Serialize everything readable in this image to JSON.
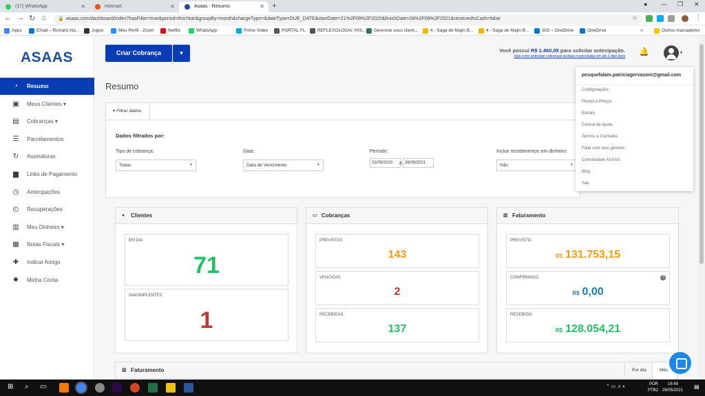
{
  "browser": {
    "tabs": [
      {
        "label": "(17) WhatsApp",
        "color": "#25d366"
      },
      {
        "label": "Hotmart",
        "color": "#f04e23"
      },
      {
        "label": "Asaas - Resumo",
        "color": "#1e4fa0"
      }
    ],
    "new_tab": "+",
    "url": "asaas.com/dashboard/index?hasFilter=true&period=thisYear&groupBy=month&chargeType=&dateType=DUE_DATE&startDate=21%2F09%2F2020&finishDate=28%2F09%2F2021&receivedInCash=false",
    "bookmarks": [
      "Apps",
      "Email – Richard Ala...",
      "Jogos",
      "Meu Perfil - Zoom",
      "Netflix",
      "WhatsApp",
      "Prime Video",
      "PORTAL FL",
      "REFLEXOLOGIA: HIS...",
      "Gerencie seus client...",
      "4 - Saga de Majin B...",
      "4 - Saga de Majin B...",
      "S02 – OneDrive",
      "OneDrive"
    ],
    "other_bookmarks": "Outros marcadores",
    "bookmarks_more": "»"
  },
  "sidebar": {
    "logo": "ASAAS",
    "items": [
      {
        "label": "Resumo",
        "icon": "dashboard-icon",
        "glyph": "◔"
      },
      {
        "label": "Meus Clientes ▾",
        "icon": "contacts-icon",
        "glyph": "▣"
      },
      {
        "label": "Cobranças ▾",
        "icon": "money-icon",
        "glyph": "▤"
      },
      {
        "label": "Parcelamentos",
        "icon": "list-icon",
        "glyph": "☰"
      },
      {
        "label": "Assinaturas",
        "icon": "refresh-icon",
        "glyph": "↻"
      },
      {
        "label": "Links de Pagamento",
        "icon": "briefcase-icon",
        "glyph": "▆"
      },
      {
        "label": "Antecipações",
        "icon": "clock-icon",
        "glyph": "◷"
      },
      {
        "label": "Recuperações",
        "icon": "recover-icon",
        "glyph": "◴"
      },
      {
        "label": "Meu Dinheiro ▾",
        "icon": "bank-icon",
        "glyph": "▥"
      },
      {
        "label": "Notas Fiscais ▾",
        "icon": "document-icon",
        "glyph": "▦"
      },
      {
        "label": "Indicar Amigo",
        "icon": "add-user-icon",
        "glyph": "✚"
      },
      {
        "label": "Minha Conta",
        "icon": "gear-icon",
        "glyph": "✹"
      }
    ]
  },
  "header": {
    "criar_label": "Criar Cobrança",
    "caret": "▾",
    "anticip_prefix": "Você possui ",
    "anticip_value": "R$ 1.460,05",
    "anticip_suffix": " para solicitar antecipação.",
    "anticip_link": "Veja como antecipar cobranças avulsas e parceladas em até 2 dias úteis",
    "bell": "🔔",
    "avatar_caret": "▾"
  },
  "page": {
    "title": "Resumo"
  },
  "filter": {
    "tab_label": "▾  Filtrar dados",
    "subtitle": "Dados filtrados por:",
    "tipo_label": "Tipo de cobrança:",
    "tipo_value": "Todas",
    "data_label": "Data:",
    "data_value": "Data de Vencimento",
    "periodo_label": "Período:",
    "periodo_start": "21/09/2020",
    "periodo_sep": "a",
    "periodo_end": "28/09/2021",
    "incluir_label": "Incluir recebimentos em dinheiro:",
    "incluir_value": "Não"
  },
  "user_menu": {
    "email": "pesquefalam.patriciagervasoni@gmail.com",
    "items": [
      "Configurações",
      "Planos e Preços",
      "Extrato",
      "Central de Ajuda",
      "Termos e Contratos",
      "Falar com meu gerente",
      "Comunidade ASAAS",
      "Blog",
      "Sair"
    ]
  },
  "cards": {
    "clientes": {
      "title": "Clientes",
      "em_dia_label": "Em dia",
      "em_dia_value": "71",
      "inadimplentes_label": "Inadimplentes",
      "inadimplentes_value": "1"
    },
    "cobrancas": {
      "title": "Cobranças",
      "previstas_label": "Previstas",
      "previstas_value": "143",
      "vencidas_label": "Vencidas",
      "vencidas_value": "2",
      "recebidas_label": "Recebidas",
      "recebidas_value": "137"
    },
    "faturamento": {
      "title": "Faturamento",
      "currency": "R$",
      "previsto_label": "Previsto",
      "previsto_value": "131.753,15",
      "confirmado_label": "Confirmado",
      "confirmado_value": "0,00",
      "recebido_label": "Recebido",
      "recebido_value": "128.054,21",
      "help": "?"
    }
  },
  "faturamento_panel": {
    "title": "Faturamento",
    "tab_dia": "Por dia",
    "tab_mes": "Mês"
  },
  "taskbar": {
    "lang": "POR",
    "layout": "PTB2",
    "time": "16:49",
    "date": "26/05/2021"
  },
  "colors": {
    "brand": "#0a3cb5",
    "green": "#21c064",
    "red": "#c0392b",
    "orange": "#f39c12",
    "teal": "#1a7fa6"
  }
}
